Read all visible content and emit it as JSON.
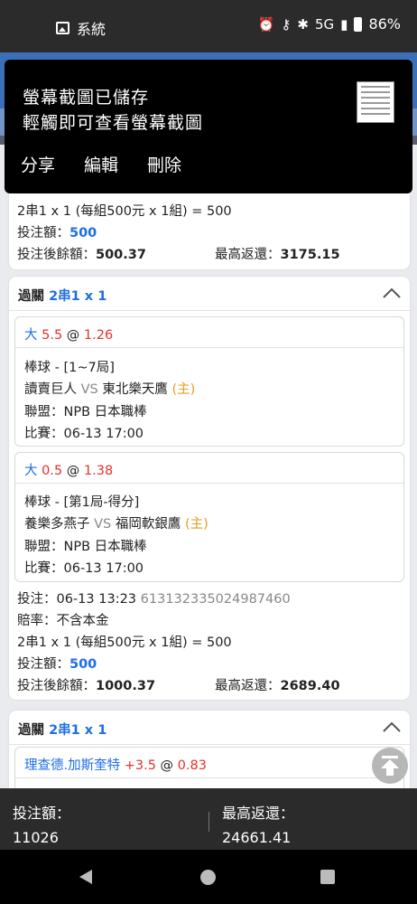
{
  "status_bar": {
    "app_name": "系統",
    "battery": "86%",
    "network": "5G"
  },
  "overlay": {
    "line1": "螢幕截圖已儲存",
    "line2": "輕觸即可查看螢幕截圖",
    "actions": {
      "share": "分享",
      "edit": "編輯",
      "delete": "刪除"
    }
  },
  "top_card": {
    "combo": "2串1 x 1 (每組500元 x 1組) = 500",
    "stake_label": "投注額：",
    "stake_value": "500",
    "balance_label": "投注後餘額：",
    "balance_value": "500.37",
    "max_label": "最高返還：",
    "max_value": "3175.15"
  },
  "card2": {
    "type_label": "過關",
    "type_value": "2串1 x 1",
    "bets": [
      {
        "selection": "大",
        "line": "5.5",
        "at": "@",
        "odds": "1.26",
        "sport": "棒球 - [1~7局]",
        "home": "讀賣巨人",
        "vs": "VS",
        "away": "東北樂天鷹",
        "home_tag": "(主)",
        "league": "聯盟：NPB 日本職棒",
        "match": "比賽：06-13 17:00"
      },
      {
        "selection": "大",
        "line": "0.5",
        "at": "@",
        "odds": "1.38",
        "sport": "棒球 - [第1局-得分]",
        "home": "養樂多燕子",
        "vs": "VS",
        "away": "福岡軟銀鷹",
        "home_tag": "(主)",
        "league": "聯盟：NPB 日本職棒",
        "match": "比賽：06-13 17:00"
      }
    ],
    "bet_time": "投注：06-13 13:23",
    "bet_id": "613132335024987460",
    "odds_note": "賠率：不含本金",
    "combo": "2串1 x 1 (每組500元 x 1組) = 500",
    "stake_label": "投注額：",
    "stake_value": "500",
    "balance_label": "投注後餘額：",
    "balance_value": "1000.37",
    "max_label": "最高返還：",
    "max_value": "2689.40"
  },
  "card3": {
    "type_label": "過關",
    "type_value": "2串1 x 1",
    "bet": {
      "selection": "理查德.加斯奎特",
      "line": "+3.5",
      "at": "@",
      "odds": "0.83"
    }
  },
  "summary": {
    "stake_label": "投注額：",
    "stake_value": "11026",
    "max_label": "最高返還：",
    "max_value": "24661.41"
  }
}
